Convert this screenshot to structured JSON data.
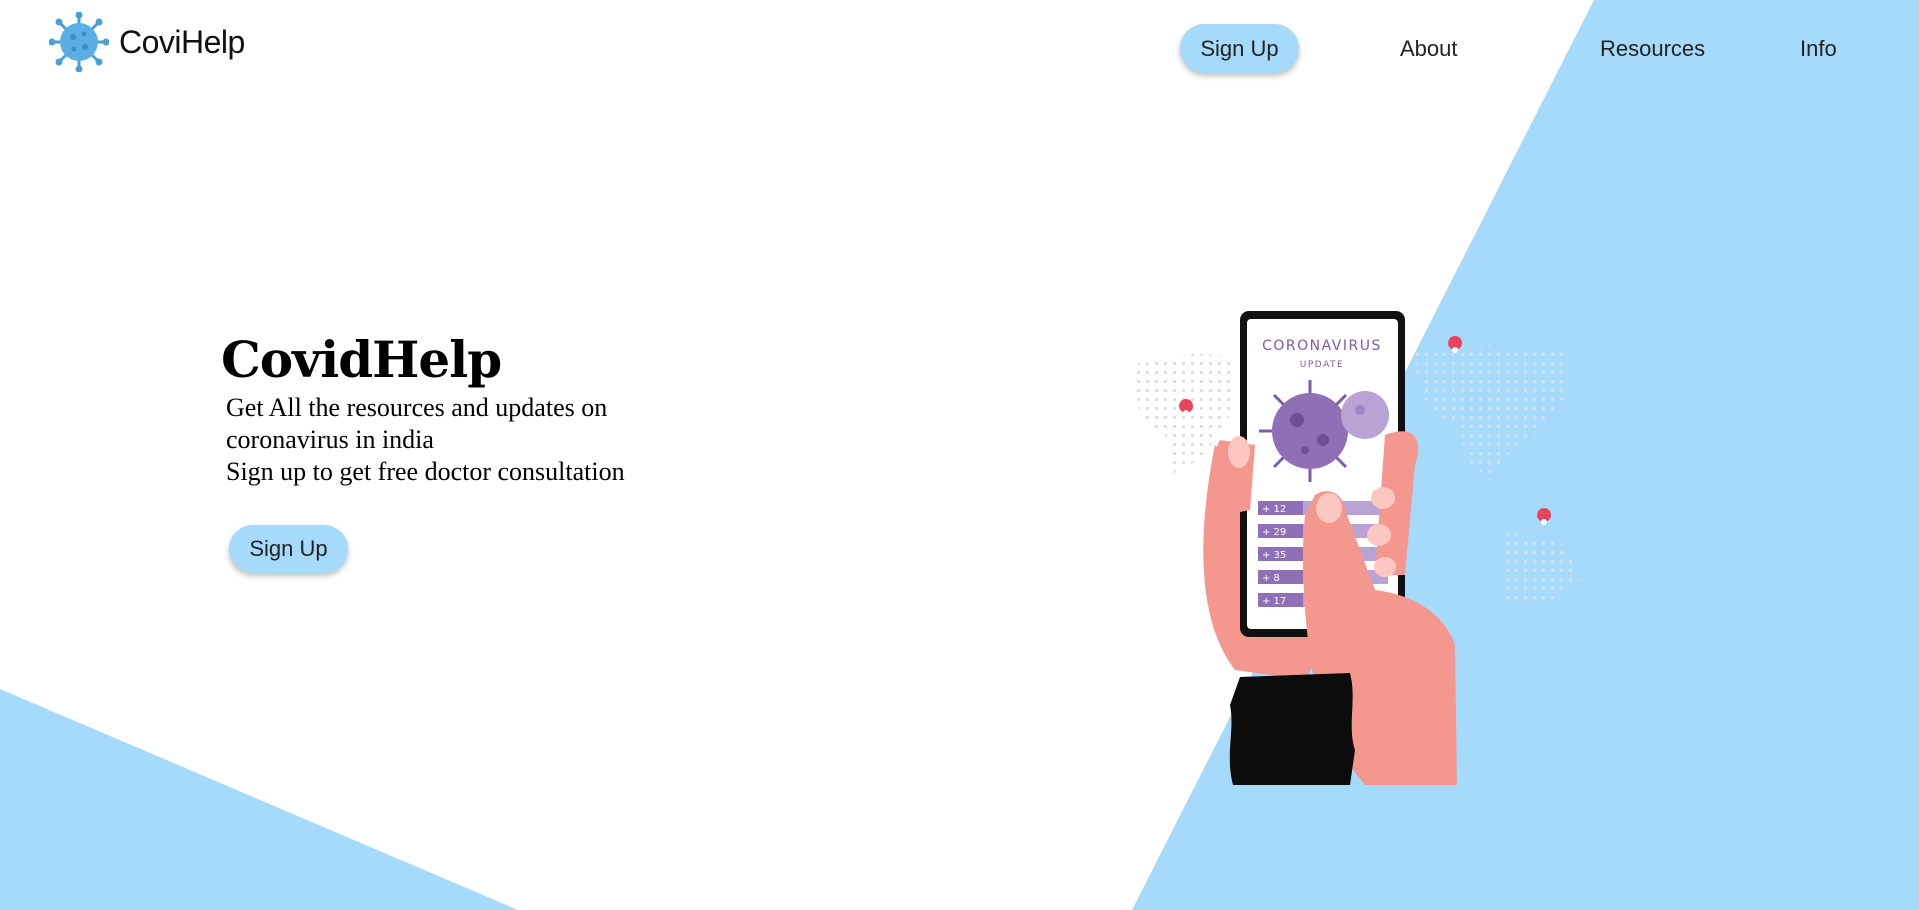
{
  "header": {
    "brand": "CoviHelp",
    "nav": {
      "signup_label": "Sign Up",
      "about_label": "About",
      "resources_label": "Resources",
      "info_label": "Info"
    }
  },
  "hero": {
    "title": "CovidHelp",
    "line1": "Get All the resources and updates on coronavirus in india",
    "line2": "Sign up to get free doctor consultation",
    "signup_label": "Sign Up"
  },
  "illustration": {
    "phone_title": "CORONAVIRUS",
    "phone_subtitle": "UPDATE",
    "stats": [
      "+ 12",
      "+ 29",
      "+ 35",
      "+ 8",
      "+ 17"
    ]
  },
  "colors": {
    "accent": "#a6dafb",
    "virus": "#8f6fb6",
    "skin": "#f4978e",
    "pin": "#e8435a"
  },
  "icons": {
    "logo": "coronavirus-icon",
    "pins": "location-pin-icon"
  }
}
